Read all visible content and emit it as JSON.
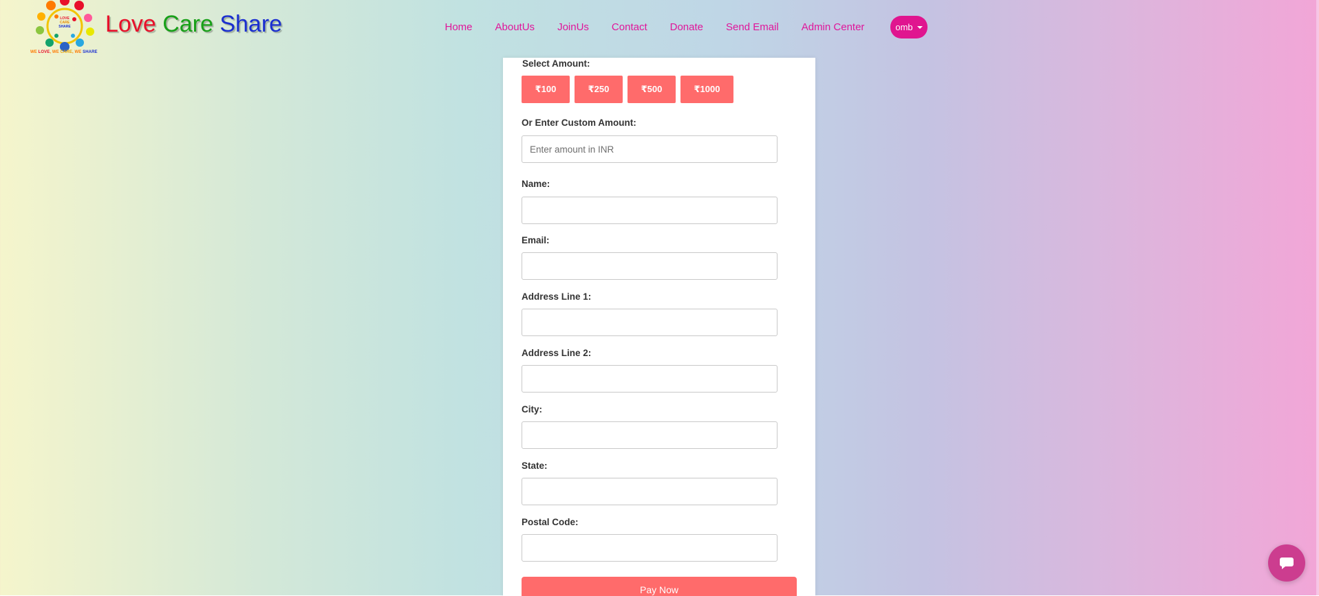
{
  "brand": {
    "words": [
      "Love",
      "Care",
      "Share"
    ],
    "colors": [
      "#e8102a",
      "#18a018",
      "#1a2ed0"
    ],
    "logo_center_text": [
      "LOVE",
      "CARE",
      "SHARE"
    ],
    "tagline_parts": [
      "WE ",
      "LOVE",
      ", WE ",
      "CARE",
      ", WE ",
      "SHARE"
    ]
  },
  "nav": {
    "links": [
      "Home",
      "AboutUs",
      "JoinUs",
      "Contact",
      "Donate",
      "Send Email",
      "Admin Center"
    ],
    "user_label": "omb"
  },
  "form": {
    "select_amount_label": "Select Amount:",
    "amounts": [
      "₹100",
      "₹250",
      "₹500",
      "₹1000"
    ],
    "custom_amount_label": "Or Enter Custom Amount:",
    "custom_amount_placeholder": "Enter amount in INR",
    "name_label": "Name:",
    "email_label": "Email:",
    "address1_label": "Address Line 1:",
    "address2_label": "Address Line 2:",
    "city_label": "City:",
    "state_label": "State:",
    "postal_label": "Postal Code:",
    "pay_label": "Pay Now"
  },
  "colors": {
    "accent": "#ff6b6b",
    "nav_link": "#e0159a",
    "user_button": "#e0158f",
    "chat_button": "#cc3d8f"
  },
  "icons": {
    "chat": "chat-bubble-icon",
    "logo": "people-circle-logo"
  }
}
